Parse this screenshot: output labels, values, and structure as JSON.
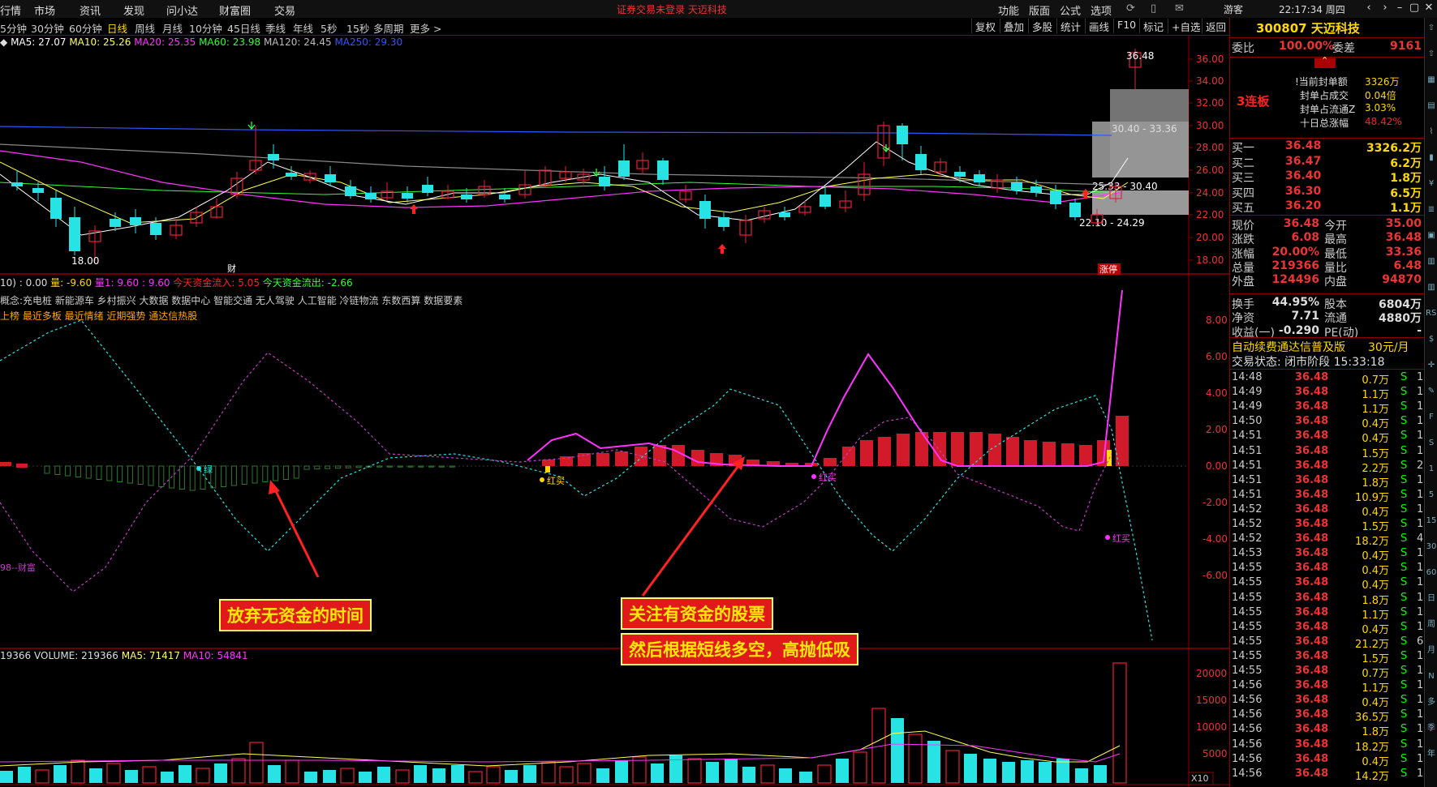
{
  "topmenu": {
    "items": [
      "行情",
      "市场",
      "资讯",
      "发现",
      "问小达",
      "财富圈",
      "交易"
    ],
    "center_title": "证券交易未登录  天迈科技",
    "right_items": [
      "功能",
      "版面",
      "公式",
      "选项"
    ],
    "guest": "游客",
    "clock": "22:17:34 周四"
  },
  "periods": {
    "items": [
      "5分钟",
      "30分钟",
      "60分钟",
      "日线",
      "周线",
      "月线",
      "10分钟",
      "45日线",
      "季线",
      "年线",
      "5秒",
      "15秒",
      "多周期",
      "更多 >"
    ],
    "active": "日线"
  },
  "toolbar": [
    "复权",
    "叠加",
    "多股",
    "统计",
    "画线",
    "F10",
    "标记",
    "+自选",
    "返回"
  ],
  "ma_legend": {
    "ma5": "MA5: 27.07",
    "ma10": "MA10: 25.26",
    "ma20": "MA20: 25.35",
    "ma60": "MA60: 23.98",
    "ma120": "MA120: 24.45",
    "ma250": "MA250: 29.30"
  },
  "price_chart": {
    "y_labels": [
      "36.00",
      "34.00",
      "32.00",
      "30.00",
      "28.00",
      "26.00",
      "24.00",
      "22.00",
      "20.00",
      "18.00"
    ],
    "annotations": {
      "high": "36.48",
      "low": "18.00",
      "zone1": "30.40 - 33.36",
      "zone2": "25.33 - 30.40",
      "zone3": "22.10 - 24.29",
      "cai": "财",
      "zhangting": "涨停"
    }
  },
  "indicator": {
    "header_left": "10) : 0.00",
    "liang": "量: -9.60",
    "liang1": "量1: 9.60",
    "val3": ": 9.60",
    "flow_in": "今天资金流入: 5.05",
    "flow_out": "今天资金流出: -2.66",
    "concepts": "概念:充电桩 新能源车 乡村振兴 大数据 数据中心 智能交通 无人驾驶 人工智能 冷链物流 东数西算 数据要素",
    "tags": "上榜 最近多板 最近情绪 近期强势 通达信热股",
    "y_labels": [
      "8.00",
      "6.00",
      "4.00",
      "2.00",
      "0.00",
      "-2.00",
      "-4.00",
      "-6.00"
    ],
    "markers": {
      "lv": "绿",
      "hongmai1": "红买",
      "hongmai2": "红买",
      "hongmai3": "红买",
      "caifu": "98--财富"
    }
  },
  "volume": {
    "header_left": "19366",
    "volume": "VOLUME: 219366",
    "ma5": "MA5: 71417",
    "ma10": "MA10: 54841",
    "y_labels": [
      "20000",
      "15000",
      "10000",
      "5000"
    ],
    "unit": "X10"
  },
  "annotations": {
    "a1": "放弃无资金的时间",
    "a2": "关注有资金的股票",
    "a3": "然后根据短线多空，高抛低吸"
  },
  "stock": {
    "code_name": "300807 天迈科技",
    "weibi_label": "委比",
    "weibi": "100.00%",
    "weicha_label": "委差",
    "weicha": "9161",
    "lianban": "3连板",
    "fengdan": [
      {
        "label": "!当前封单额",
        "value": "3326万"
      },
      {
        "label": "封单占成交",
        "value": "0.04倍"
      },
      {
        "label": "封单占流通Z",
        "value": "3.03%"
      },
      {
        "label": "十日总涨幅",
        "value": "48.42%"
      }
    ],
    "bids": [
      {
        "label": "买一",
        "price": "36.48",
        "vol": "3326.2万"
      },
      {
        "label": "买二",
        "price": "36.47",
        "vol": "6.2万"
      },
      {
        "label": "买三",
        "price": "36.40",
        "vol": "1.8万"
      },
      {
        "label": "买四",
        "price": "36.30",
        "vol": "6.5万"
      },
      {
        "label": "买五",
        "price": "36.20",
        "vol": "1.1万"
      }
    ],
    "quote": [
      {
        "l1": "现价",
        "v1": "36.48",
        "l2": "今开",
        "v2": "35.00"
      },
      {
        "l1": "涨跌",
        "v1": "6.08",
        "l2": "最高",
        "v2": "36.48"
      },
      {
        "l1": "涨幅",
        "v1": "20.00%",
        "l2": "最低",
        "v2": "33.36"
      },
      {
        "l1": "总量",
        "v1": "219366",
        "l2": "量比",
        "v2": "6.48"
      },
      {
        "l1": "外盘",
        "v1": "124496",
        "l2": "内盘",
        "v2": "94870"
      }
    ],
    "quote2": [
      {
        "l1": "换手",
        "v1": "44.95%",
        "l2": "股本",
        "v2": "6804万"
      },
      {
        "l1": "净资",
        "v1": "7.71",
        "l2": "流通",
        "v2": "4880万"
      },
      {
        "l1": "收益(一)",
        "v1": "-0.290",
        "l2": "PE(动)",
        "v2": "-"
      }
    ],
    "promo": "自动续费通达信普及版",
    "promo_price": "30元/月",
    "status": "交易状态: 闭市阶段 15:33:18"
  },
  "ticks": [
    {
      "t": "14:48",
      "p": "36.48",
      "v": "0.7万",
      "s": "S",
      "n": "1"
    },
    {
      "t": "14:49",
      "p": "36.48",
      "v": "1.1万",
      "s": "S",
      "n": "1"
    },
    {
      "t": "14:49",
      "p": "36.48",
      "v": "1.1万",
      "s": "S",
      "n": "1"
    },
    {
      "t": "14:50",
      "p": "36.48",
      "v": "0.4万",
      "s": "S",
      "n": "1"
    },
    {
      "t": "14:51",
      "p": "36.48",
      "v": "0.4万",
      "s": "S",
      "n": "1"
    },
    {
      "t": "14:51",
      "p": "36.48",
      "v": "1.5万",
      "s": "S",
      "n": "1"
    },
    {
      "t": "14:51",
      "p": "36.48",
      "v": "2.2万",
      "s": "S",
      "n": "2"
    },
    {
      "t": "14:51",
      "p": "36.48",
      "v": "1.8万",
      "s": "S",
      "n": "1"
    },
    {
      "t": "14:51",
      "p": "36.48",
      "v": "10.9万",
      "s": "S",
      "n": "1"
    },
    {
      "t": "14:52",
      "p": "36.48",
      "v": "0.4万",
      "s": "S",
      "n": "1"
    },
    {
      "t": "14:52",
      "p": "36.48",
      "v": "1.5万",
      "s": "S",
      "n": "1"
    },
    {
      "t": "14:52",
      "p": "36.48",
      "v": "18.2万",
      "s": "S",
      "n": "4"
    },
    {
      "t": "14:53",
      "p": "36.48",
      "v": "0.4万",
      "s": "S",
      "n": "1"
    },
    {
      "t": "14:55",
      "p": "36.48",
      "v": "0.4万",
      "s": "S",
      "n": "1"
    },
    {
      "t": "14:55",
      "p": "36.48",
      "v": "0.4万",
      "s": "S",
      "n": "1"
    },
    {
      "t": "14:55",
      "p": "36.48",
      "v": "1.8万",
      "s": "S",
      "n": "1"
    },
    {
      "t": "14:55",
      "p": "36.48",
      "v": "1.1万",
      "s": "S",
      "n": "1"
    },
    {
      "t": "14:55",
      "p": "36.48",
      "v": "0.4万",
      "s": "S",
      "n": "1"
    },
    {
      "t": "14:55",
      "p": "36.48",
      "v": "21.2万",
      "s": "S",
      "n": "6"
    },
    {
      "t": "14:55",
      "p": "36.48",
      "v": "1.5万",
      "s": "S",
      "n": "1"
    },
    {
      "t": "14:55",
      "p": "36.48",
      "v": "0.7万",
      "s": "S",
      "n": "1"
    },
    {
      "t": "14:56",
      "p": "36.48",
      "v": "1.1万",
      "s": "S",
      "n": "1"
    },
    {
      "t": "14:56",
      "p": "36.48",
      "v": "0.4万",
      "s": "S",
      "n": "1"
    },
    {
      "t": "14:56",
      "p": "36.48",
      "v": "36.5万",
      "s": "S",
      "n": "1"
    },
    {
      "t": "14:56",
      "p": "36.48",
      "v": "1.8万",
      "s": "S",
      "n": "1"
    },
    {
      "t": "14:56",
      "p": "36.48",
      "v": "18.2万",
      "s": "S",
      "n": "1"
    },
    {
      "t": "14:56",
      "p": "36.48",
      "v": "0.4万",
      "s": "S",
      "n": "1"
    },
    {
      "t": "14:56",
      "p": "36.48",
      "v": "14.2万",
      "s": "S",
      "n": "1"
    }
  ],
  "side_icons": [
    "up-arrow-icon",
    "up-arrow-icon",
    "grid-icon",
    "table-icon",
    "chart-icon",
    "candle-icon",
    "fund-icon",
    "list-icon",
    "f10-icon",
    "bars-icon",
    "bars-icon",
    "rsi-icon",
    "dollar-icon",
    "cross-icon",
    "pen-icon",
    "f-icon",
    "s-icon",
    "one-icon",
    "five-icon",
    "fifteen-icon",
    "thirty-icon",
    "sixty-icon",
    "day-icon",
    "week-icon",
    "month-icon",
    "n-icon",
    "multi-icon",
    "season-icon",
    "year-icon"
  ],
  "side_icon_labels": [
    "",
    "",
    "",
    "",
    "",
    "",
    "",
    "",
    "",
    "",
    "",
    "RSI",
    "$",
    "",
    "",
    "F",
    "S",
    "1",
    "5",
    "15",
    "30",
    "60",
    "日",
    "周",
    "月",
    "N",
    "多",
    "季",
    "年"
  ],
  "colors": {
    "up": "#e8203a",
    "down": "#27e3e3",
    "ma5": "#ffffff",
    "ma10": "#ffff55",
    "ma20": "#ff33ff",
    "ma60": "#33ff33",
    "ma120": "#999999",
    "ma250": "#3355ff"
  }
}
